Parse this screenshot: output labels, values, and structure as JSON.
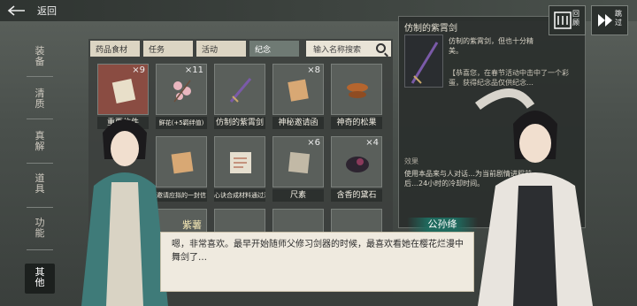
{
  "topbar": {
    "back_label": "返回"
  },
  "sidebar": {
    "items": [
      {
        "label": "装\n备"
      },
      {
        "label": "清\n质"
      },
      {
        "label": "真\n解"
      },
      {
        "label": "道\n具"
      },
      {
        "label": "功\n能"
      },
      {
        "label": "其\n他"
      }
    ]
  },
  "tabs": [
    {
      "label": "药品食材"
    },
    {
      "label": "任务"
    },
    {
      "label": "活动"
    },
    {
      "label": "纪念"
    }
  ],
  "search": {
    "placeholder": "输入名称搜索"
  },
  "items": [
    {
      "label": "重要信件",
      "count": "×9"
    },
    {
      "label": "鲜花(+5羁绊值)",
      "count": "×11"
    },
    {
      "label": "仿制的紫霄剑",
      "count": ""
    },
    {
      "label": "神秘邀请函",
      "count": "×8"
    },
    {
      "label": "神奇的松果",
      "count": ""
    },
    {
      "label": "",
      "count": ""
    },
    {
      "label": "邀请应拟的一封信",
      "count": ""
    },
    {
      "label": "心诀合成材料通过清单",
      "count": ""
    },
    {
      "label": "尺素",
      "count": "×6"
    },
    {
      "label": "含香的黛石",
      "count": "×4"
    }
  ],
  "detail": {
    "title": "仿制的紫霄剑",
    "desc": "仿制的紫霄剑，但也十分精美。",
    "body": "【恭喜您，在春节活动中击中了一个彩蛋，获得纪念品仅供纪念…",
    "effect_label": "效果",
    "effect_text": "使用本品来与人对话…为当前剧情进程前后…24小时的冷却时间。"
  },
  "controls": {
    "review_label": "回顾",
    "skip_label": "跳过"
  },
  "dialog": {
    "speaker_left": "紫薯",
    "speaker_right": "公孙绛",
    "text": "嗯，非常喜欢。最早开始随师父修习剑器的时候，最喜欢看她在樱花烂漫中舞剑了…"
  }
}
